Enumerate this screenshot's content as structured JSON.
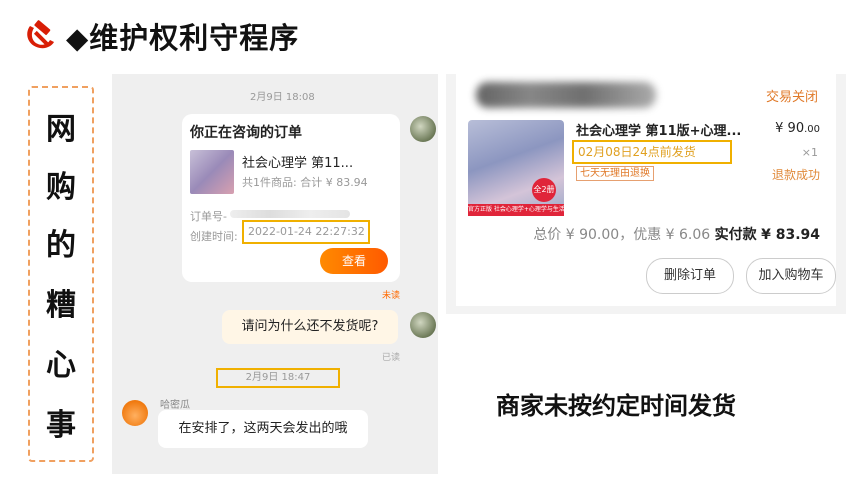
{
  "header": {
    "title": "◆维护权利守程序",
    "emblem_icon": "hammer-sickle-icon",
    "emblem_color": "#d81e06"
  },
  "vertical_box": {
    "chars": [
      "网",
      "购",
      "的",
      "糟",
      "心",
      "事"
    ]
  },
  "chat": {
    "timestamp_1": "2月9日 18:08",
    "order_card": {
      "title": "你正在咨询的订单",
      "product_name": "社会心理学 第11...",
      "summary": "共1件商品: 合计 ¥ 83.94",
      "order_no_label": "订单号-",
      "created_label": "创建时间:",
      "created_time": "2022-01-24 22:27:32",
      "view_button": "查看"
    },
    "status_unread": "未读",
    "question": "请问为什么还不发货呢?",
    "status_read": "已读",
    "timestamp_2": "2月9日 18:47",
    "bot_name": "哈密瓜",
    "bot_reply": "在安排了，这两天会发出的哦",
    "accent_color": "#ff6a00"
  },
  "order": {
    "status": "交易关闭",
    "product_name": "社会心理学 第11版+心理...",
    "price_main": "¥ 90",
    "price_decimal": ".00",
    "ship_promise": "02月08日24点前发货",
    "quantity": "×1",
    "return_tag": "七天无理由退换",
    "refund_status": "退款成功",
    "thumb_badge": "全2册",
    "thumb_strip": "官方正版  社会心理学+心理学与生活",
    "total_line_prefix": "总价 ¥ 90.00，优惠 ¥ 6.06",
    "total_paid_label": "实付款",
    "total_paid_value": "¥ 83.94",
    "delete_button": "删除订单",
    "cart_button": "加入购物车"
  },
  "caption": "商家未按约定时间发货"
}
